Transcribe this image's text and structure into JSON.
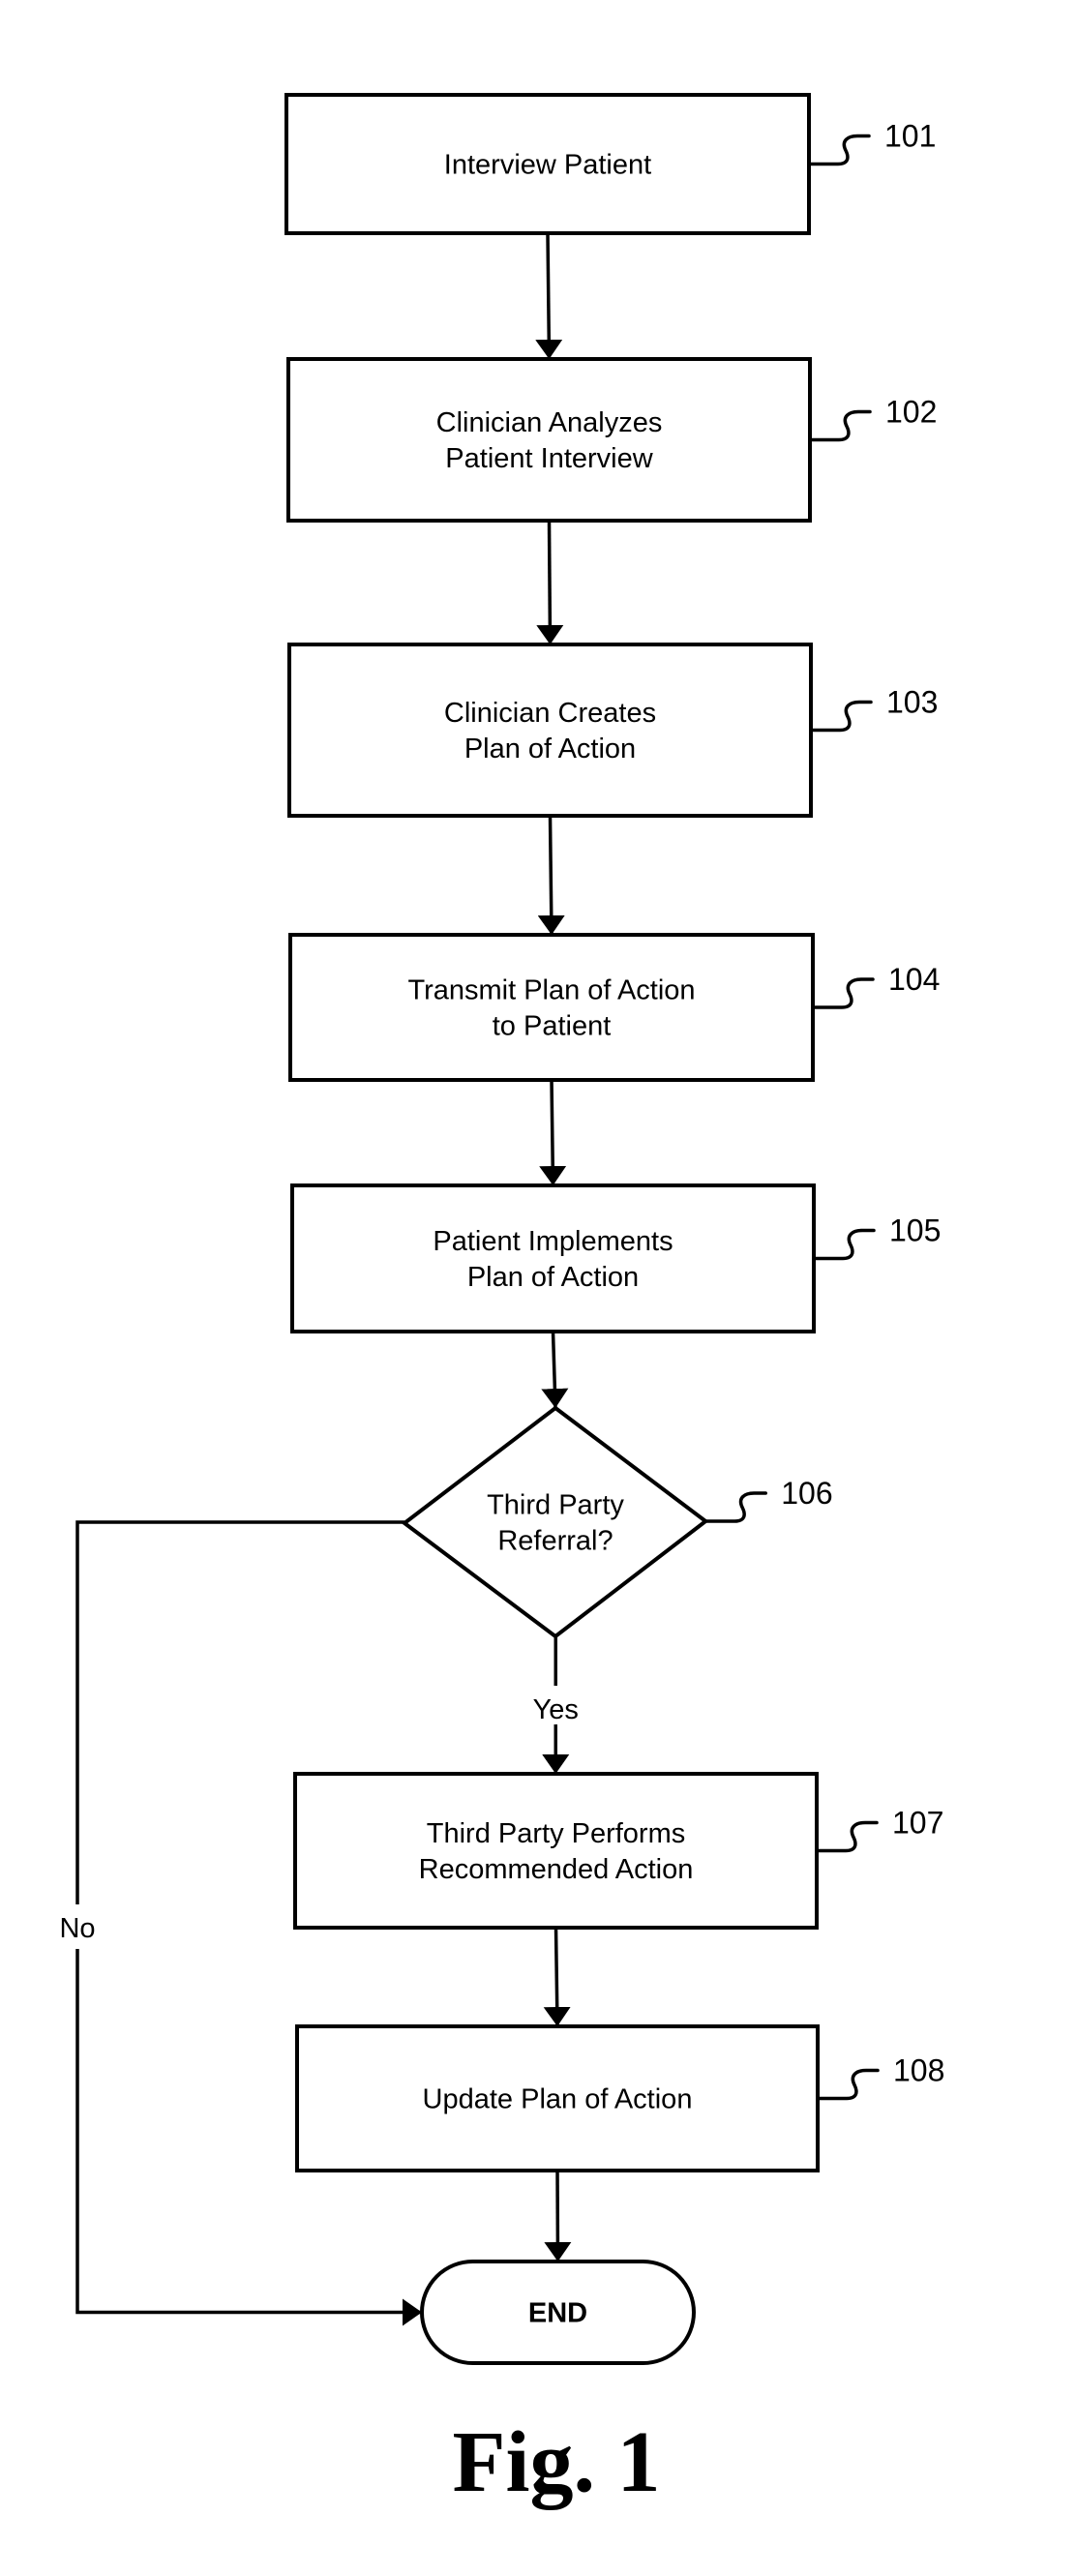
{
  "figure": {
    "caption": "Fig. 1",
    "steps": [
      {
        "id": "101",
        "type": "process",
        "lines": [
          "Interview Patient"
        ]
      },
      {
        "id": "102",
        "type": "process",
        "lines": [
          "Clinician Analyzes",
          "Patient Interview"
        ]
      },
      {
        "id": "103",
        "type": "process",
        "lines": [
          "Clinician Creates",
          "Plan of Action"
        ]
      },
      {
        "id": "104",
        "type": "process",
        "lines": [
          "Transmit Plan of Action",
          "to Patient"
        ]
      },
      {
        "id": "105",
        "type": "process",
        "lines": [
          "Patient Implements",
          "Plan of Action"
        ]
      },
      {
        "id": "106",
        "type": "decision",
        "lines": [
          "Third Party",
          "Referral?"
        ]
      },
      {
        "id": "107",
        "type": "process",
        "lines": [
          "Third Party Performs",
          "Recommended Action"
        ]
      },
      {
        "id": "108",
        "type": "process",
        "lines": [
          "Update Plan of Action"
        ]
      },
      {
        "id": "end",
        "type": "terminal",
        "lines": [
          "END"
        ]
      }
    ],
    "edges": [
      {
        "from": "101",
        "to": "102",
        "label": ""
      },
      {
        "from": "102",
        "to": "103",
        "label": ""
      },
      {
        "from": "103",
        "to": "104",
        "label": ""
      },
      {
        "from": "104",
        "to": "105",
        "label": ""
      },
      {
        "from": "105",
        "to": "106",
        "label": ""
      },
      {
        "from": "106",
        "to": "107",
        "label": "Yes"
      },
      {
        "from": "107",
        "to": "108",
        "label": ""
      },
      {
        "from": "108",
        "to": "end",
        "label": ""
      },
      {
        "from": "106",
        "to": "end",
        "label": "No"
      }
    ]
  }
}
